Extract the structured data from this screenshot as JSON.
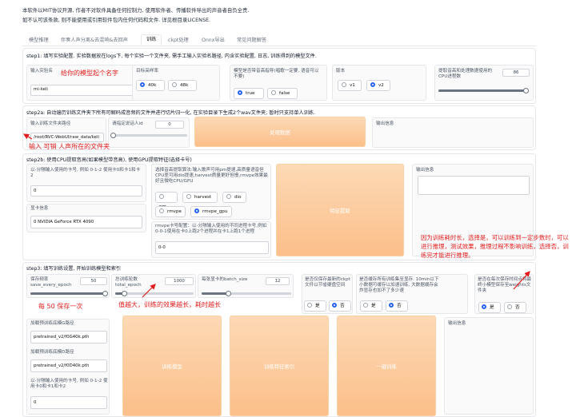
{
  "notice": {
    "line1": "本软件以MIT协议开源, 作者不对软件具备任何控制力, 使用软件者、传播软件导出的声音者自负全责.",
    "line2": "如不认可该条款, 则不能使用或引用软件包内任何代码和文件. 详见根目录LICENSE."
  },
  "tabs": [
    "模型推理",
    "伴奏人声分离&去混响&去回声",
    "训练",
    "ckpt处理",
    "Onnx导出",
    "常见问题解答"
  ],
  "step1": {
    "title": "step1: 填写实验配置. 实验数据放在logs下, 每个实验一个文件夹, 需手工输入实验名路径, 内含实验配置, 日志, 训练得到的模型文件.",
    "exp_name_label": "输入实验名",
    "exp_name_value": "mi-keli",
    "sr_label": "目标采样率",
    "sr_options": [
      "40k",
      "48k"
    ],
    "pitch_label": "模型是否带音高指导(唱歌一定要, 语音可以不要)",
    "pitch_options": [
      "true",
      "false"
    ],
    "version_label": "版本",
    "version_options": [
      "v1",
      "v2"
    ],
    "cpu_label": "提取音高和处理数据使用的CPU进程数",
    "cpu_value": "86"
  },
  "step2a": {
    "title": "step2a: 自动遍历训练文件夹下所有可解码成音频的文件并进行切片归一化, 在实验目录下生成2个wav文件夹; 暂时只支持单人训练.",
    "dir_label": "输入训练文件夹路径",
    "dir_value": "/root/RVC-WebUI/raw_data/keli",
    "spk_label": "请指定说话人id",
    "spk_value": "0",
    "process_button": "处理数据",
    "output_label": "输出信息"
  },
  "step2b": {
    "title": "step2b: 使用CPU提取音高(如果模型带音高), 使用GPU提取特征(选择卡号)",
    "gpus_label": "以-分隔输入使用的卡号, 例如 0-1-2 使用卡0和卡1和卡2",
    "gpus_value": "0",
    "gpu_info_label": "显卡信息",
    "gpu_info_value": "0 NVIDIA GeForce RTX 4090",
    "f0_label": "选择音高提取算法:输入歌声可用pm提速,高质量语音但CPU差可用dio提速,harvest质量更好但慢,rmvpe效果最好且微吃CPU/GPU",
    "f0_options": [
      "pm",
      "harvest",
      "dio",
      "rmvpe",
      "rmvpe_gpu"
    ],
    "rmvpe_label": "rmvpe卡号配置：以-分隔输入使用的不同进程卡号,例如0-0-1使用在卡0上跑2个进程并在卡1上跑1个进程",
    "rmvpe_value": "0-0",
    "extract_button": "特征提取",
    "output_label": "输出信息"
  },
  "step3": {
    "title": "step3: 填写训练设置, 开始训练模型和索引",
    "save_label": "保存频率save_every_epoch",
    "save_value": "50",
    "epoch_label": "总训练轮数total_epoch",
    "epoch_value": "1000",
    "batch_label": "每张显卡的batch_size",
    "batch_value": "12",
    "latest_label": "是否仅保存最新的ckpt文件以节省硬盘空间",
    "cache_label": "是否缓存所有训练集至显存. 10min以下小数据可缓存以加速训练, 大数据缓存会炸显存也加不了多少速",
    "weights_label": "是否在每次保存时间点将最终小模型保存至weights文件夹",
    "yes": "是",
    "no": "否",
    "pg_label": "加载预训练底模G路径",
    "pg_value": "pretrained_v2/f0G40k.pth",
    "pd_label": "加载预训练底模D路径",
    "pd_value": "pretrained_v2/f0D40k.pth",
    "gpus3_label": "以-分隔输入使用的卡号, 例如 0-1-2 使用卡0和卡1和卡2",
    "gpus3_value": "0",
    "train_button": "训练模型",
    "index_button": "训练特征索引",
    "onekey_button": "一键训练",
    "output_label": "输出信息"
  },
  "annotations": {
    "name": "给你的模型起个名字",
    "folder": "输入 可销  人声所在的文件夹",
    "save": "每 50 保存一次",
    "epoch": "值越大，训练的效果越长，耗时越长",
    "weights": "因为训练耗时长，选择是，可以训练到一定步数时，可以进行推理，测试效果，推理过程不影响训练，选择否，训练完才能进行推理。"
  },
  "colors": {
    "annotation": "#e11d1d",
    "button_top": "#fdd9b5",
    "button_bottom": "#fbbf8a",
    "radio_on": "#2563eb"
  }
}
